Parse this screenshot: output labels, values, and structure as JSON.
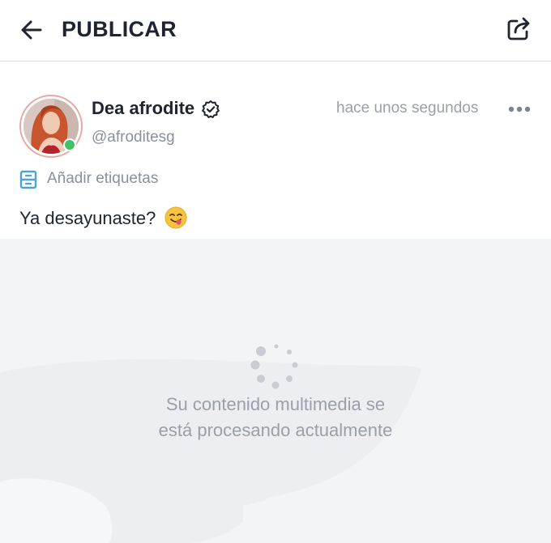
{
  "header": {
    "title": "PUBLICAR",
    "back_icon": "arrow-left-icon",
    "share_icon": "share-icon"
  },
  "post": {
    "author_name": "Dea afrodite",
    "author_handle": "@afroditesg",
    "verified_icon": "verified-badge-icon",
    "online_status": "online",
    "timestamp": "hace unos segundos",
    "menu_icon": "more-horizontal-icon",
    "tags_label": "Añadir etiquetas",
    "tags_icon": "tag-icon",
    "text": "Ya desayunaste?",
    "emoji": "face-savoring-food-emoji"
  },
  "media": {
    "status_line1": "Su contenido multimedia se",
    "status_line2": "está procesando actualmente",
    "spinner_icon": "loading-spinner-icon"
  },
  "colors": {
    "text_primary": "#1f2430",
    "text_muted": "#8a909d",
    "accent_tag": "#4da3d6",
    "online": "#3fc265",
    "media_bg": "#f3f4f6"
  }
}
